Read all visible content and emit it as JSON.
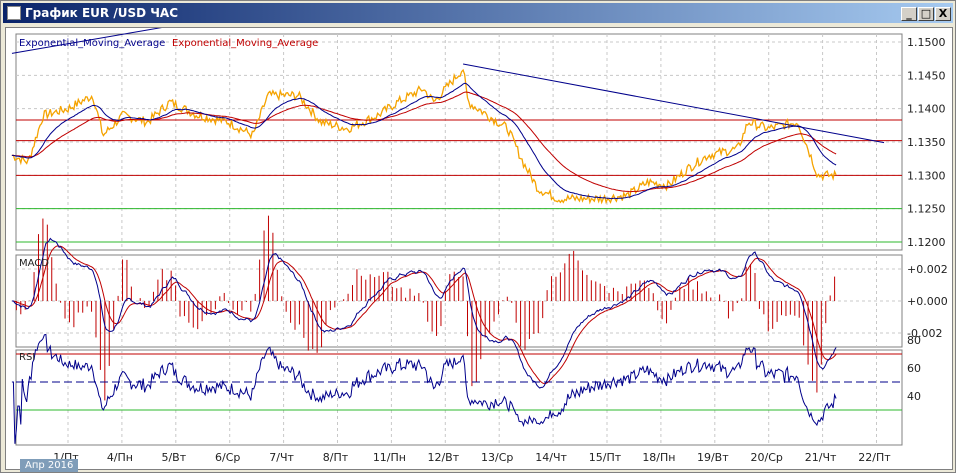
{
  "window": {
    "title": "График EUR /USD  ЧАС",
    "minimize": "_",
    "maximize": "□",
    "close": "X"
  },
  "legend": {
    "ema1": "Exponential_Moving_Average",
    "ema2": "Exponential_Moving_Average"
  },
  "panels": {
    "macd": "MACD",
    "rsi": "RSI"
  },
  "period_label": "Апр 2016",
  "colors": {
    "price": "#f5a300",
    "ema_fast": "#00008b",
    "ema_slow": "#c00000",
    "red_level": "#c00000",
    "green_level": "#2db82d"
  },
  "chart_data": {
    "type": "line",
    "title": "EUR/USD H1",
    "price_axis": {
      "ticks": [
        "1.1500",
        "1.1450",
        "1.1400",
        "1.1350",
        "1.1300",
        "1.1250",
        "1.1200"
      ],
      "ylim": [
        1.1188,
        1.1512
      ]
    },
    "macd_axis": {
      "ticks": [
        "+0.002",
        "+0.000",
        "-0.002"
      ]
    },
    "rsi_axis": {
      "ticks": [
        "80",
        "60",
        "40"
      ]
    },
    "x_ticks": [
      "1/Пт",
      "4/Пн",
      "5/Вт",
      "6/Ср",
      "7/Чт",
      "8/Пт",
      "11/Пн",
      "12/Вт",
      "13/Ср",
      "14/Чт",
      "15/Пт",
      "18/Пн",
      "19/Вт",
      "20/Ср",
      "21/Чт",
      "22/Пт"
    ],
    "price_points": [
      [
        -1.04,
        1.133
      ],
      [
        -0.74,
        1.132
      ],
      [
        -0.46,
        1.139
      ],
      [
        0,
        1.14
      ],
      [
        0.46,
        1.142
      ],
      [
        0.65,
        1.136
      ],
      [
        1.02,
        1.139
      ],
      [
        1.48,
        1.138
      ],
      [
        1.89,
        1.141
      ],
      [
        2.41,
        1.139
      ],
      [
        2.97,
        1.138
      ],
      [
        3.43,
        1.136
      ],
      [
        3.71,
        1.142
      ],
      [
        4.27,
        1.142
      ],
      [
        4.69,
        1.138
      ],
      [
        5.19,
        1.137
      ],
      [
        5.75,
        1.139
      ],
      [
        6.12,
        1.141
      ],
      [
        6.59,
        1.143
      ],
      [
        6.79,
        1.141
      ],
      [
        7.33,
        1.146
      ],
      [
        7.42,
        1.141
      ],
      [
        7.79,
        1.139
      ],
      [
        8.16,
        1.137
      ],
      [
        8.44,
        1.132
      ],
      [
        8.72,
        1.128
      ],
      [
        9.09,
        1.1265
      ],
      [
        9.46,
        1.1265
      ],
      [
        9.91,
        1.1265
      ],
      [
        10.39,
        1.127
      ],
      [
        10.76,
        1.129
      ],
      [
        11.13,
        1.1285
      ],
      [
        11.5,
        1.131
      ],
      [
        11.87,
        1.133
      ],
      [
        12.43,
        1.134
      ],
      [
        12.62,
        1.138
      ],
      [
        12.99,
        1.137
      ],
      [
        13.54,
        1.138
      ],
      [
        13.73,
        1.134
      ],
      [
        13.91,
        1.13
      ],
      [
        14.25,
        1.13
      ]
    ],
    "horizontal_levels": {
      "red": [
        1.1383,
        1.1352,
        1.13
      ],
      "green": [
        1.125,
        1.12
      ]
    },
    "rsi_levels": [
      70,
      50,
      30
    ],
    "trendlines": [
      [
        [
          -1.04,
          1.1483
        ],
        [
          1.76,
          1.1522
        ]
      ],
      [
        [
          7.33,
          1.1467
        ],
        [
          15.14,
          1.1349
        ]
      ]
    ]
  }
}
